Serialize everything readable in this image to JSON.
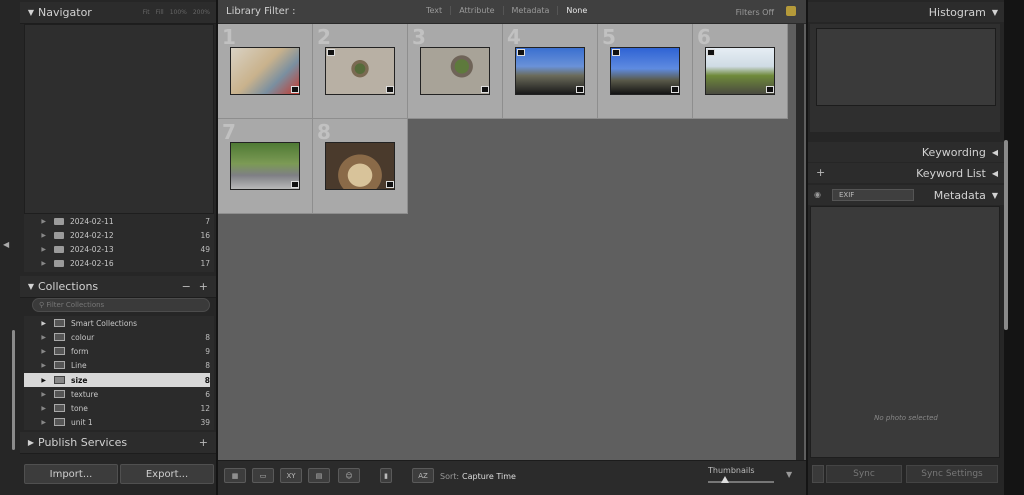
{
  "navigator": {
    "title": "Navigator",
    "zoom_options": [
      "Fit",
      "Fill",
      "100%",
      "200%"
    ]
  },
  "folders": [
    {
      "name": "2024-02-11",
      "count": "7"
    },
    {
      "name": "2024-02-12",
      "count": "16"
    },
    {
      "name": "2024-02-13",
      "count": "49"
    },
    {
      "name": "2024-02-16",
      "count": "17"
    }
  ],
  "collections": {
    "title": "Collections",
    "search_placeholder": "Filter Collections",
    "smart_label": "Smart Collections",
    "items": [
      {
        "name": "colour",
        "count": "8"
      },
      {
        "name": "form",
        "count": "9"
      },
      {
        "name": "Line",
        "count": "8"
      },
      {
        "name": "size",
        "count": "8",
        "selected": true
      },
      {
        "name": "texture",
        "count": "6"
      },
      {
        "name": "tone",
        "count": "12"
      },
      {
        "name": "unit 1",
        "count": "39"
      }
    ]
  },
  "publish": {
    "title": "Publish Services"
  },
  "buttons": {
    "import": "Import...",
    "export": "Export..."
  },
  "filter": {
    "title": "Library Filter :",
    "options": [
      "Text",
      "Attribute",
      "Metadata",
      "None"
    ],
    "status": "Filters Off"
  },
  "grid": {
    "photos": [
      {
        "num": "1"
      },
      {
        "num": "2"
      },
      {
        "num": "3"
      },
      {
        "num": "4"
      },
      {
        "num": "5"
      },
      {
        "num": "6"
      },
      {
        "num": "7"
      },
      {
        "num": "8"
      }
    ]
  },
  "toolbar": {
    "sort_label": "Sort:",
    "sort_value": "Capture Time",
    "thumbnails_label": "Thumbnails",
    "thumbnail_size": 0.25
  },
  "right": {
    "histogram": "Histogram",
    "keywording": "Keywording",
    "keyword_list": "Keyword List",
    "metadata": "Metadata",
    "metadata_preset": "EXIF",
    "no_photo": "No photo selected",
    "sync": "Sync",
    "sync_settings": "Sync Settings"
  },
  "colors": {
    "accent_lock": "#b59a3a",
    "selected_row": "#d8d8d8"
  }
}
